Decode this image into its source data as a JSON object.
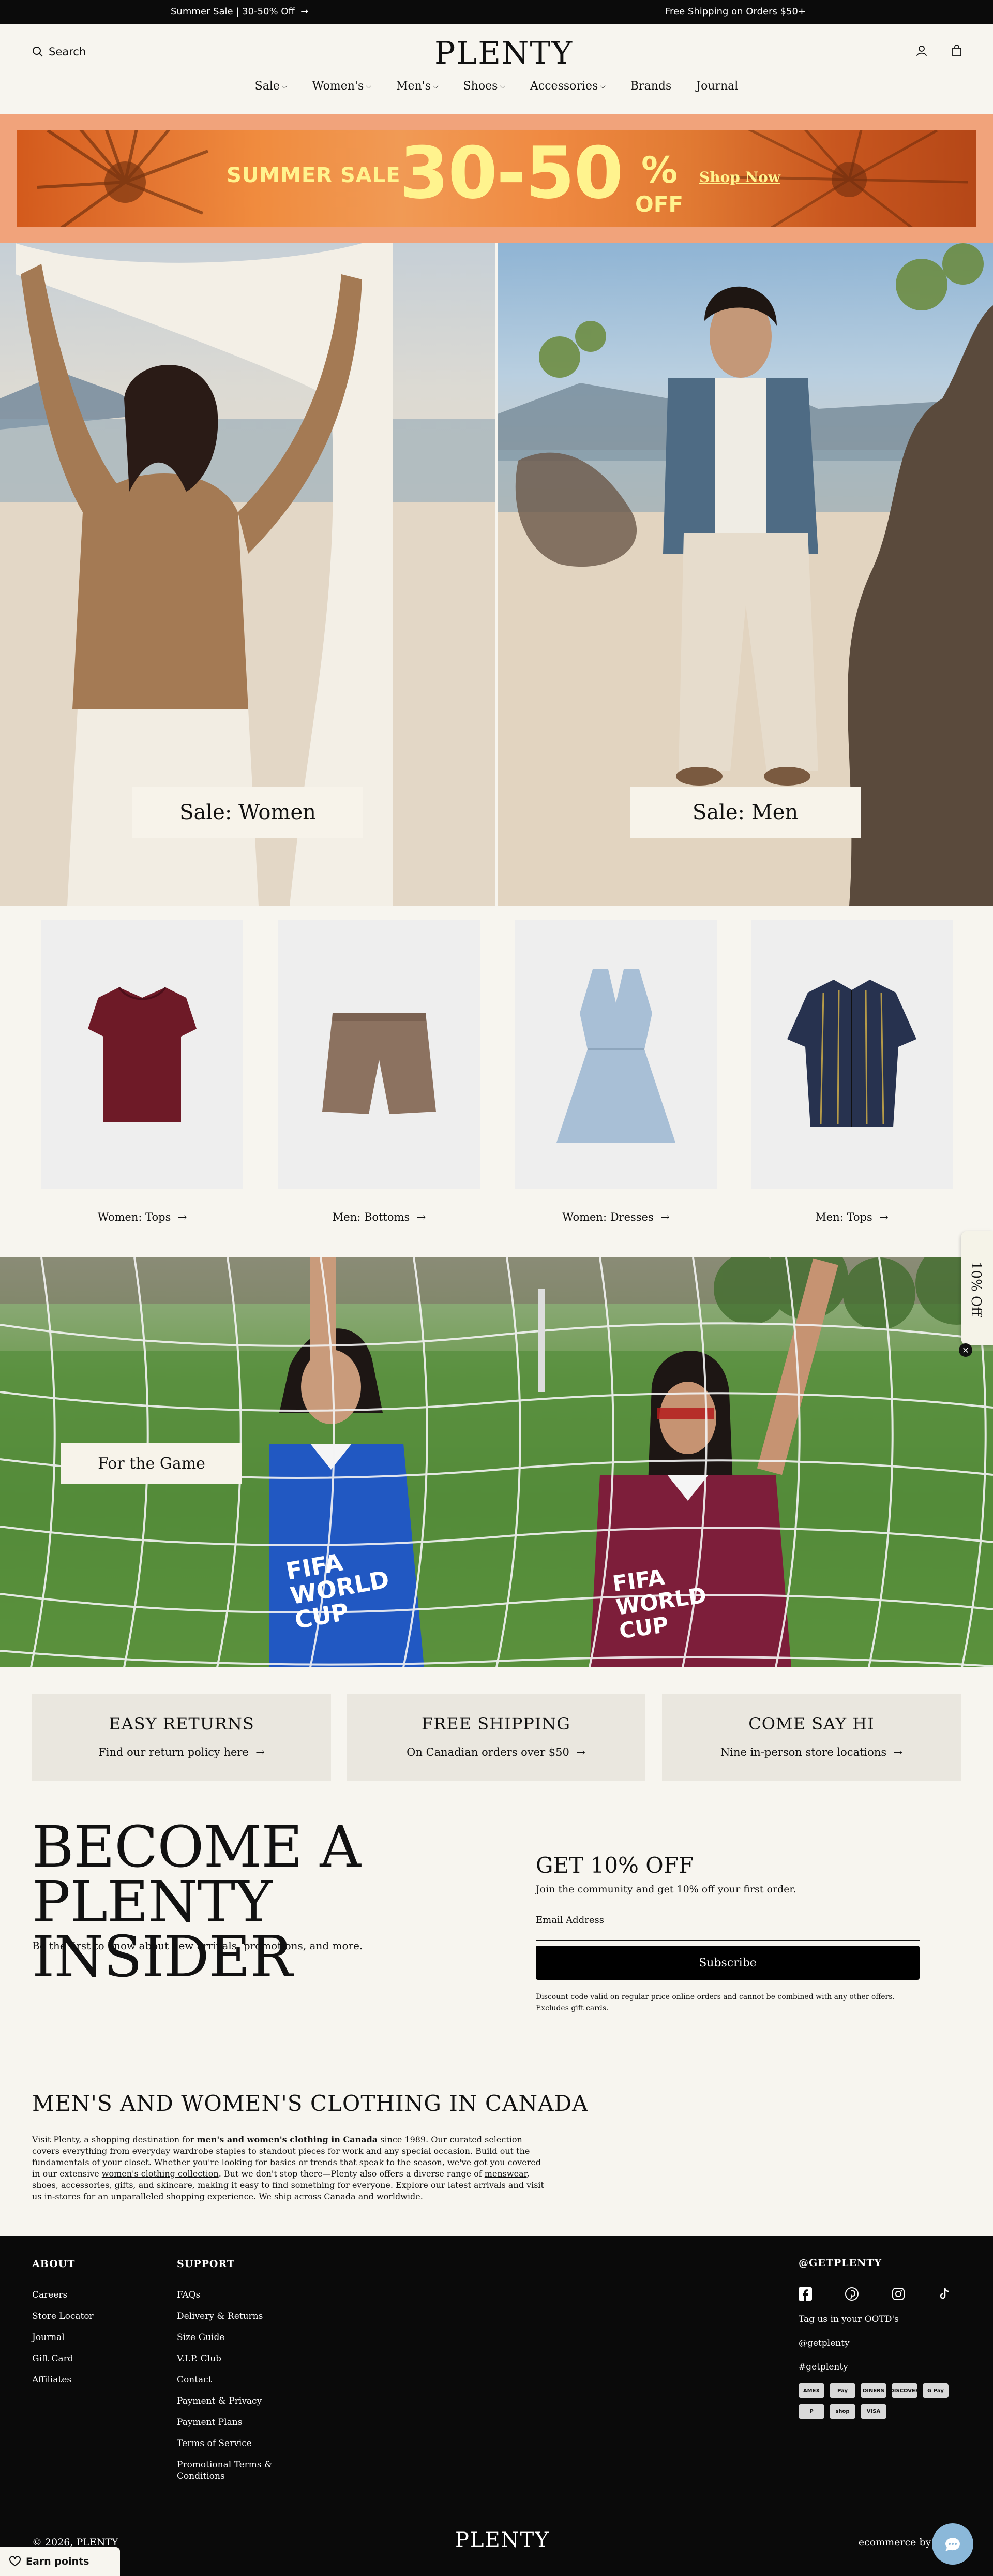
{
  "announcement": {
    "left": "Summer Sale | 30-50% Off",
    "right": "Free Shipping on Orders $50+"
  },
  "header": {
    "search_label": "Search",
    "logo": "PLENTY",
    "nav": [
      {
        "label": "Sale"
      },
      {
        "label": "Women's"
      },
      {
        "label": "Men's"
      },
      {
        "label": "Shoes"
      },
      {
        "label": "Accessories"
      },
      {
        "label": "Brands"
      },
      {
        "label": "Journal"
      }
    ]
  },
  "promo": {
    "label": "SUMMER SALE",
    "big": "30-50",
    "percent": "%",
    "off": "OFF",
    "link": "Shop Now"
  },
  "hero": {
    "left_button": "Sale: Women",
    "right_button": "Sale: Men"
  },
  "categories": [
    {
      "label": "Women: Tops"
    },
    {
      "label": "Men: Bottoms"
    },
    {
      "label": "Women: Dresses"
    },
    {
      "label": "Men: Tops"
    }
  ],
  "game": {
    "button": "For the Game",
    "jersey_text": "FIFA WORLD CUP"
  },
  "side_tab": {
    "label": "10% Off"
  },
  "perks": [
    {
      "title": "EASY RETURNS",
      "subtitle": "Find our return policy here"
    },
    {
      "title": "FREE SHIPPING",
      "subtitle": "On Canadian orders over $50"
    },
    {
      "title": "COME SAY HI",
      "subtitle": "Nine in-person store locations"
    }
  ],
  "insider": {
    "title_line1": "BECOME A PLENTY",
    "title_line2": "INSIDER",
    "subtitle": "Be the first to know about new arrivals, promotions, and more.",
    "offer_title": "GET 10% OFF",
    "offer_sub": "Join the community and get 10% off your first order.",
    "email_placeholder": "Email Address",
    "subscribe_label": "Subscribe",
    "disclaimer": "Discount code valid on regular price online orders and cannot be combined with any other offers. Excludes gift cards."
  },
  "about_section": {
    "title": "MEN'S AND WOMEN'S CLOTHING IN CANADA",
    "p1": "Visit Plenty, a shopping destination for ",
    "p1_bold": "men's and women's clothing in Canada",
    "p2": " since 1989. Our curated selection covers everything from everyday wardrobe staples to standout pieces for work and any special occasion. Build out the fundamentals of your closet. Whether you're looking for basics or trends that speak to the season, we've got you covered in our extensive ",
    "link1": "women's clothing collection",
    "p3": ". But we don't stop there—Plenty also offers a diverse range of ",
    "link2": "menswear",
    "p4": ", shoes, accessories, gifts, and skincare, making it easy to find something for everyone. Explore our latest arrivals and visit us in-stores for an unparalleled shopping experience. We ship across Canada and worldwide."
  },
  "footer": {
    "about_heading": "ABOUT",
    "about_links": [
      "Careers",
      "Store Locator",
      "Journal",
      "Gift Card",
      "Affiliates"
    ],
    "support_heading": "SUPPORT",
    "support_links": [
      "FAQs",
      "Delivery & Returns",
      "Size Guide",
      "V.I.P. Club",
      "Contact",
      "Payment & Privacy",
      "Payment Plans",
      "Terms of Service",
      "Promotional Terms & Conditions"
    ],
    "social_heading": "@GETPLENTY",
    "tag_line": "Tag us in your OOTD's",
    "handle": "@getplenty",
    "hashtag": "#getplenty",
    "payments_row1": [
      "AMEX",
      "Pay",
      "DINERS",
      "DISCOVER",
      "G Pay"
    ],
    "payments_row2": [
      "P",
      "shop",
      "VISA"
    ],
    "copyright": "© 2026, PLENTY",
    "logo": "PLENTY",
    "powered": "ecommerce by po"
  },
  "earn_points": "Earn points"
}
